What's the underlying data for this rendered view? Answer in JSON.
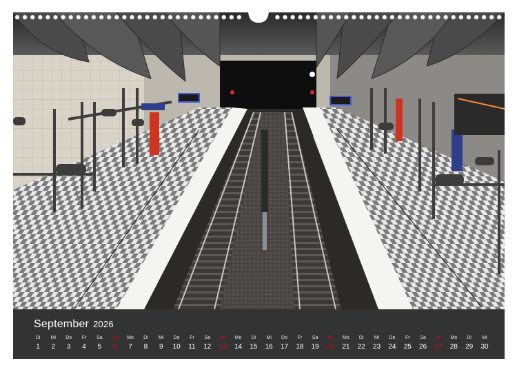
{
  "calendar": {
    "month": "September",
    "year": "2026",
    "days": [
      {
        "dow": "Di",
        "num": "1"
      },
      {
        "dow": "Mi",
        "num": "2"
      },
      {
        "dow": "Do",
        "num": "3"
      },
      {
        "dow": "Fr",
        "num": "4"
      },
      {
        "dow": "Sa",
        "num": "5"
      },
      {
        "dow": "So",
        "num": "6",
        "sunday": true
      },
      {
        "dow": "Mo",
        "num": "7"
      },
      {
        "dow": "Di",
        "num": "8"
      },
      {
        "dow": "Mi",
        "num": "9"
      },
      {
        "dow": "Do",
        "num": "10"
      },
      {
        "dow": "Fr",
        "num": "11"
      },
      {
        "dow": "Sa",
        "num": "12"
      },
      {
        "dow": "So",
        "num": "13",
        "sunday": true
      },
      {
        "dow": "Mo",
        "num": "14"
      },
      {
        "dow": "Di",
        "num": "15"
      },
      {
        "dow": "Mi",
        "num": "16"
      },
      {
        "dow": "Do",
        "num": "17"
      },
      {
        "dow": "Fr",
        "num": "18"
      },
      {
        "dow": "Sa",
        "num": "19"
      },
      {
        "dow": "So",
        "num": "20",
        "sunday": true
      },
      {
        "dow": "Mo",
        "num": "21"
      },
      {
        "dow": "Di",
        "num": "22"
      },
      {
        "dow": "Mi",
        "num": "23"
      },
      {
        "dow": "Do",
        "num": "24"
      },
      {
        "dow": "Fr",
        "num": "25"
      },
      {
        "dow": "Sa",
        "num": "26"
      },
      {
        "dow": "So",
        "num": "27",
        "sunday": true
      },
      {
        "dow": "Mo",
        "num": "28"
      },
      {
        "dow": "Di",
        "num": "29"
      },
      {
        "dow": "Mi",
        "num": "30"
      }
    ]
  },
  "colors": {
    "calendar_bg": "#333333",
    "sunday": "#e2001a",
    "text": "#ffffff"
  }
}
